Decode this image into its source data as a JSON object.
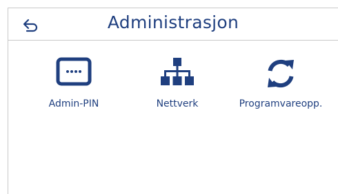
{
  "header": {
    "title": "Administrasjon",
    "back_icon": "back-arrow-icon"
  },
  "tiles": [
    {
      "label": "Admin-PIN",
      "icon": "pin-entry-icon"
    },
    {
      "label": "Nettverk",
      "icon": "network-icon"
    },
    {
      "label": "Programvareopp.",
      "icon": "sync-icon"
    }
  ],
  "colors": {
    "accent": "#1f3f7f",
    "divider": "#c7c7c7",
    "background": "#ffffff"
  }
}
